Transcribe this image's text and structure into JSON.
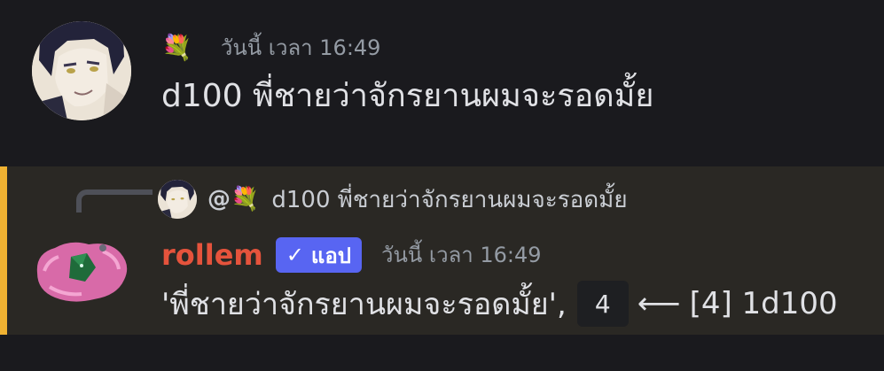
{
  "message1": {
    "badge": "💐",
    "timestamp": "วันนี้ เวลา 16:49",
    "content": "d100 พี่ชายว่าจักรยานผมจะรอดมั้ย"
  },
  "message2": {
    "reply": {
      "mention": "@💐",
      "preview": "d100 พี่ชายว่าจักรยานผมจะรอดมั้ย"
    },
    "username": "rollem",
    "app_tag": {
      "check": "✓",
      "label": "แอป"
    },
    "timestamp": "วันนี้ เวลา 16:49",
    "content": {
      "text": "'พี่ชายว่าจักรยานผมจะรอดมั้ย',",
      "result": "4",
      "arrow": "⟵",
      "detail": "[4] 1d100"
    }
  },
  "colors": {
    "background": "#1a1a1e",
    "highlight_bg": "#2a2824",
    "highlight_bar": "#f0b232",
    "username": "#e5533c",
    "app_tag": "#5865f2",
    "timestamp": "#949ba4"
  }
}
